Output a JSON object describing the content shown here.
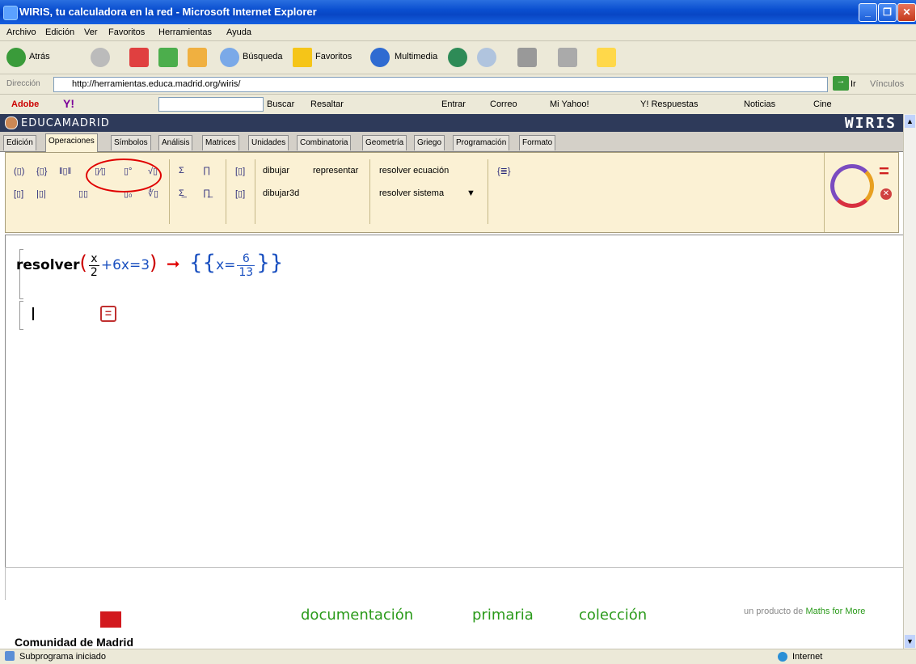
{
  "window": {
    "title": "WIRIS, tu calculadora en la red - Microsoft Internet Explorer"
  },
  "menu": [
    "Archivo",
    "Edición",
    "Ver",
    "Favoritos",
    "Herramientas",
    "Ayuda"
  ],
  "toolbar": {
    "back": "Atrás",
    "search": "Búsqueda",
    "favorites": "Favoritos",
    "media": "Multimedia"
  },
  "address": {
    "label": "Dirección",
    "url": "http://herramientas.educa.madrid.org/wiris/",
    "go": "Ir",
    "links": "Vínculos"
  },
  "linksbar": {
    "adobe": "Adobe",
    "search": "Buscar",
    "highlight": "Resaltar",
    "enter": "Entrar",
    "mail": "Correo",
    "myyahoo": "Mi Yahoo!",
    "answers": "Y! Respuestas",
    "news": "Noticias",
    "cinema": "Cine"
  },
  "header": {
    "brand": "EDUCAMADRID",
    "product": "WIRIS"
  },
  "tabs": [
    "Edición",
    "Operaciones",
    "Símbolos",
    "Análisis",
    "Matrices",
    "Unidades",
    "Combinatoria",
    "Geometría",
    "Griego",
    "Programación",
    "Formato"
  ],
  "palette": {
    "draw": "dibujar",
    "plot": "representar",
    "draw3d": "dibujar3d",
    "solve_eq": "resolver ecuación",
    "solve_sys": "resolver sistema"
  },
  "formula": {
    "fn": "resolver",
    "num": "x",
    "den": "2",
    "rest": "+6x=3",
    "res_var": "x=",
    "res_num": "6",
    "res_den": "13"
  },
  "footer": {
    "doc": "documentación",
    "primary": "primaria",
    "collection": "colección",
    "product_prefix": "un producto de",
    "product_brand": "Maths for More",
    "community": "Comunidad de Madrid"
  },
  "status": {
    "text": "Subprograma iniciado",
    "zone": "Internet"
  }
}
